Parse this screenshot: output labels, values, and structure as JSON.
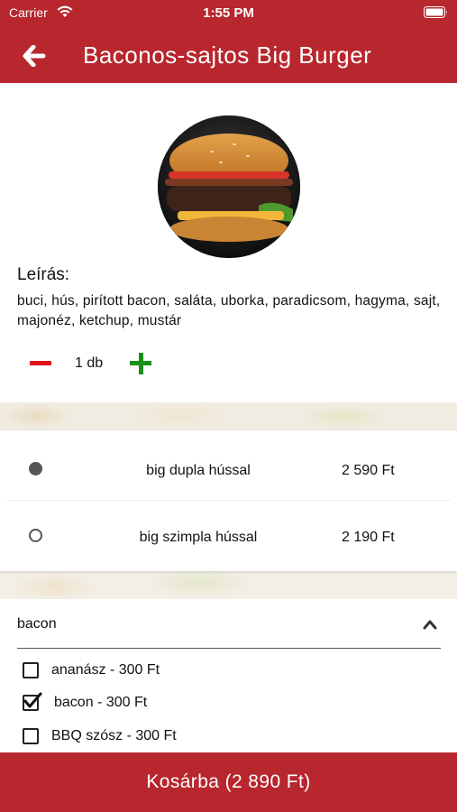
{
  "status_bar": {
    "carrier": "Carrier",
    "time": "1:55 PM"
  },
  "header": {
    "title": "Baconos-sajtos Big Burger",
    "back_icon": "arrow-left-icon",
    "color": "#b8262e"
  },
  "product": {
    "image": "burger-photo",
    "description_heading": "Leírás:",
    "description": "buci, hús, pirított bacon, saláta, uborka, paradicsom, hagyma, sajt, majonéz, ketchup, mustár"
  },
  "quantity": {
    "value": "1 db",
    "minus_icon": "minus-icon",
    "plus_icon": "plus-icon"
  },
  "variants": [
    {
      "name": "big dupla hússal",
      "price": "2 590 Ft",
      "selected": true
    },
    {
      "name": "big szimpla hússal",
      "price": "2 190 Ft",
      "selected": false
    }
  ],
  "extras": {
    "selected_group": "bacon",
    "options": [
      {
        "label": "ananász - 300 Ft",
        "checked": false
      },
      {
        "label": "bacon - 300 Ft",
        "checked": true
      },
      {
        "label": "BBQ szósz - 300 Ft",
        "checked": false
      }
    ]
  },
  "cart_button": {
    "label": "Kosárba (2 890 Ft)"
  }
}
